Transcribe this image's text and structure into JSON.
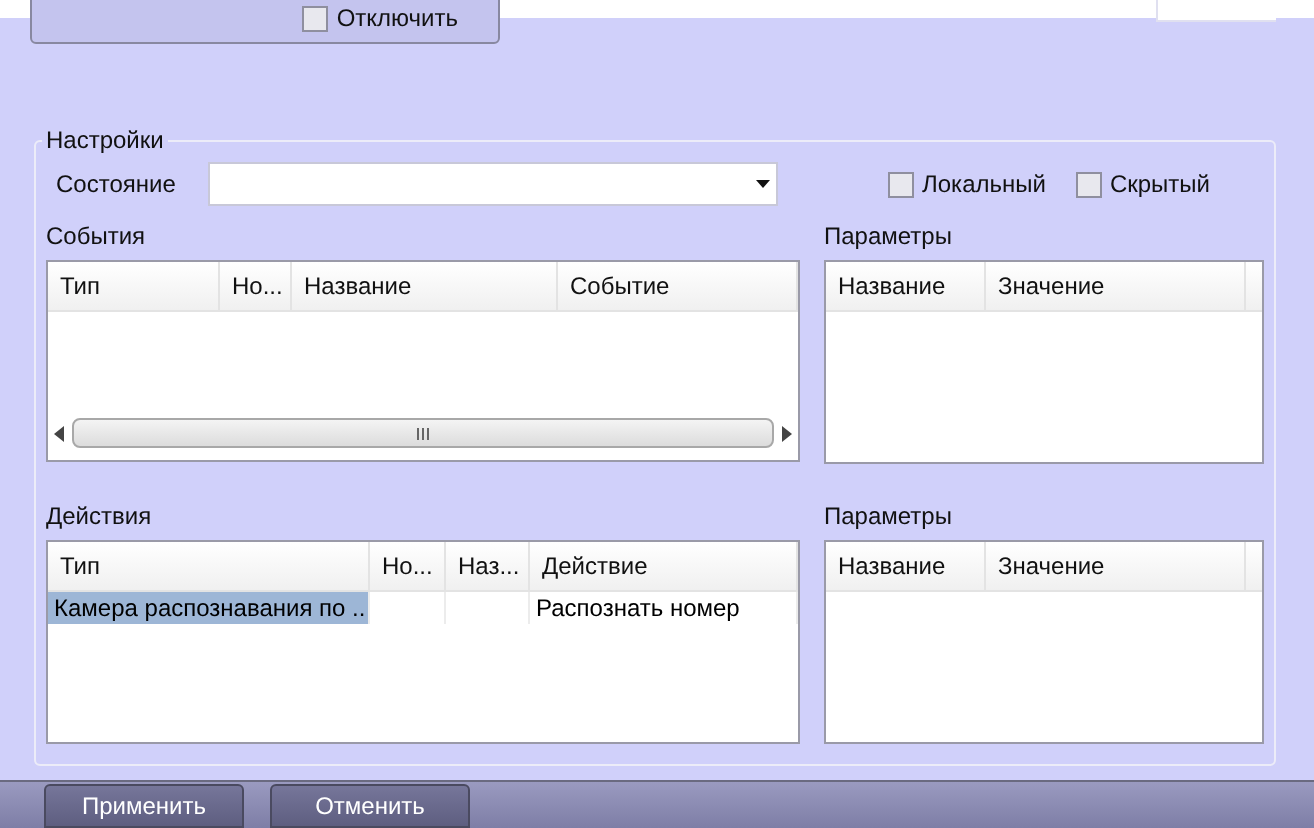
{
  "top_panel": {
    "checkbox": {
      "label": "Отключить",
      "checked": false
    }
  },
  "settings": {
    "title": "Настройки",
    "state": {
      "label": "Состояние"
    },
    "checkboxes": [
      {
        "label": "Локальный",
        "checked": false
      },
      {
        "label": "Скрытый",
        "checked": false
      }
    ],
    "events": {
      "title": "События",
      "columns": [
        "Тип",
        "Но...",
        "Название",
        "Событие"
      ]
    },
    "event_params": {
      "title": "Параметры",
      "columns": [
        "Название",
        "Значение"
      ]
    },
    "actions": {
      "title": "Действия",
      "columns": [
        "Тип",
        "Но...",
        "Наз...",
        "Действие"
      ],
      "rows": [
        {
          "cells": [
            "Камера распознавания по ..",
            "",
            "",
            "Распознать номер"
          ],
          "selected": true
        }
      ]
    },
    "action_params": {
      "title": "Параметры",
      "columns": [
        "Название",
        "Значение"
      ]
    }
  },
  "buttons": [
    "Применить",
    "Отменить"
  ]
}
